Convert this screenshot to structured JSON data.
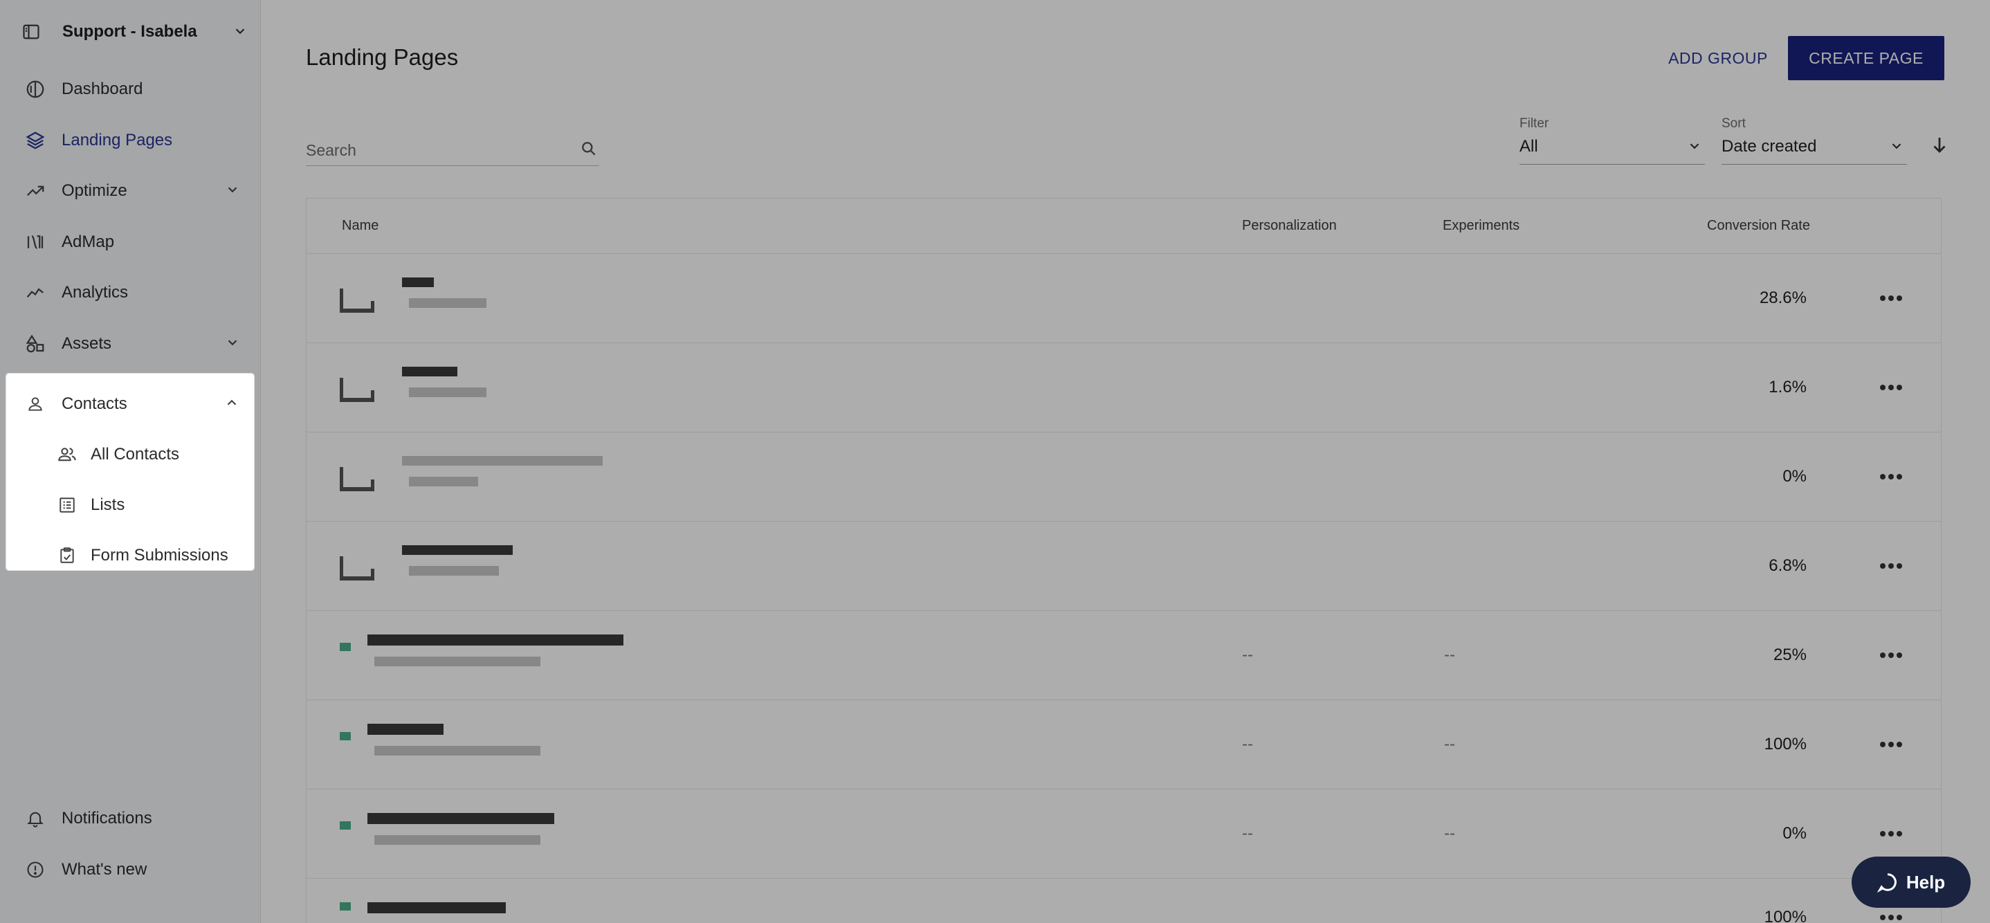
{
  "sidebar": {
    "workspace": "Support - Isabela",
    "items": [
      {
        "label": "Dashboard",
        "icon": "dashboard-icon"
      },
      {
        "label": "Landing Pages",
        "icon": "layers-icon",
        "active": true
      },
      {
        "label": "Optimize",
        "icon": "trending-up-icon",
        "has_children": true
      },
      {
        "label": "AdMap",
        "icon": "admap-icon"
      },
      {
        "label": "Analytics",
        "icon": "analytics-icon"
      },
      {
        "label": "Assets",
        "icon": "shapes-icon",
        "has_children": true
      },
      {
        "label": "Contacts",
        "icon": "person-icon",
        "expanded": true
      }
    ],
    "contacts_children": [
      {
        "label": "All Contacts",
        "icon": "people-icon"
      },
      {
        "label": "Lists",
        "icon": "list-icon"
      },
      {
        "label": "Form Submissions",
        "icon": "clipboard-check-icon"
      }
    ],
    "bottom": [
      {
        "label": "Notifications",
        "icon": "bell-icon"
      },
      {
        "label": "What's new",
        "icon": "info-circle-icon"
      }
    ]
  },
  "main": {
    "title": "Landing Pages",
    "add_group_label": "ADD GROUP",
    "create_page_label": "CREATE PAGE",
    "search_placeholder": "Search",
    "filter": {
      "caption": "Filter",
      "value": "All"
    },
    "sort": {
      "caption": "Sort",
      "value": "Date created"
    },
    "table": {
      "columns": [
        "Name",
        "Personalization",
        "Experiments",
        "Conversion Rate"
      ],
      "rows": [
        {
          "personalization": "",
          "experiments": "",
          "rate": "28.6%"
        },
        {
          "personalization": "",
          "experiments": "",
          "rate": "1.6%"
        },
        {
          "personalization": "",
          "experiments": "",
          "rate": "0%"
        },
        {
          "personalization": "",
          "experiments": "",
          "rate": "6.8%"
        },
        {
          "personalization": "--",
          "experiments": "--",
          "rate": "25%"
        },
        {
          "personalization": "--",
          "experiments": "--",
          "rate": "100%"
        },
        {
          "personalization": "--",
          "experiments": "--",
          "rate": "0%"
        },
        {
          "personalization": "",
          "experiments": "",
          "rate": "100%"
        }
      ]
    }
  },
  "help": {
    "label": "Help"
  },
  "colors": {
    "accent": "#1a237e",
    "active_nav": "#283593",
    "overlay": "rgba(0,0,0,0.32)"
  }
}
